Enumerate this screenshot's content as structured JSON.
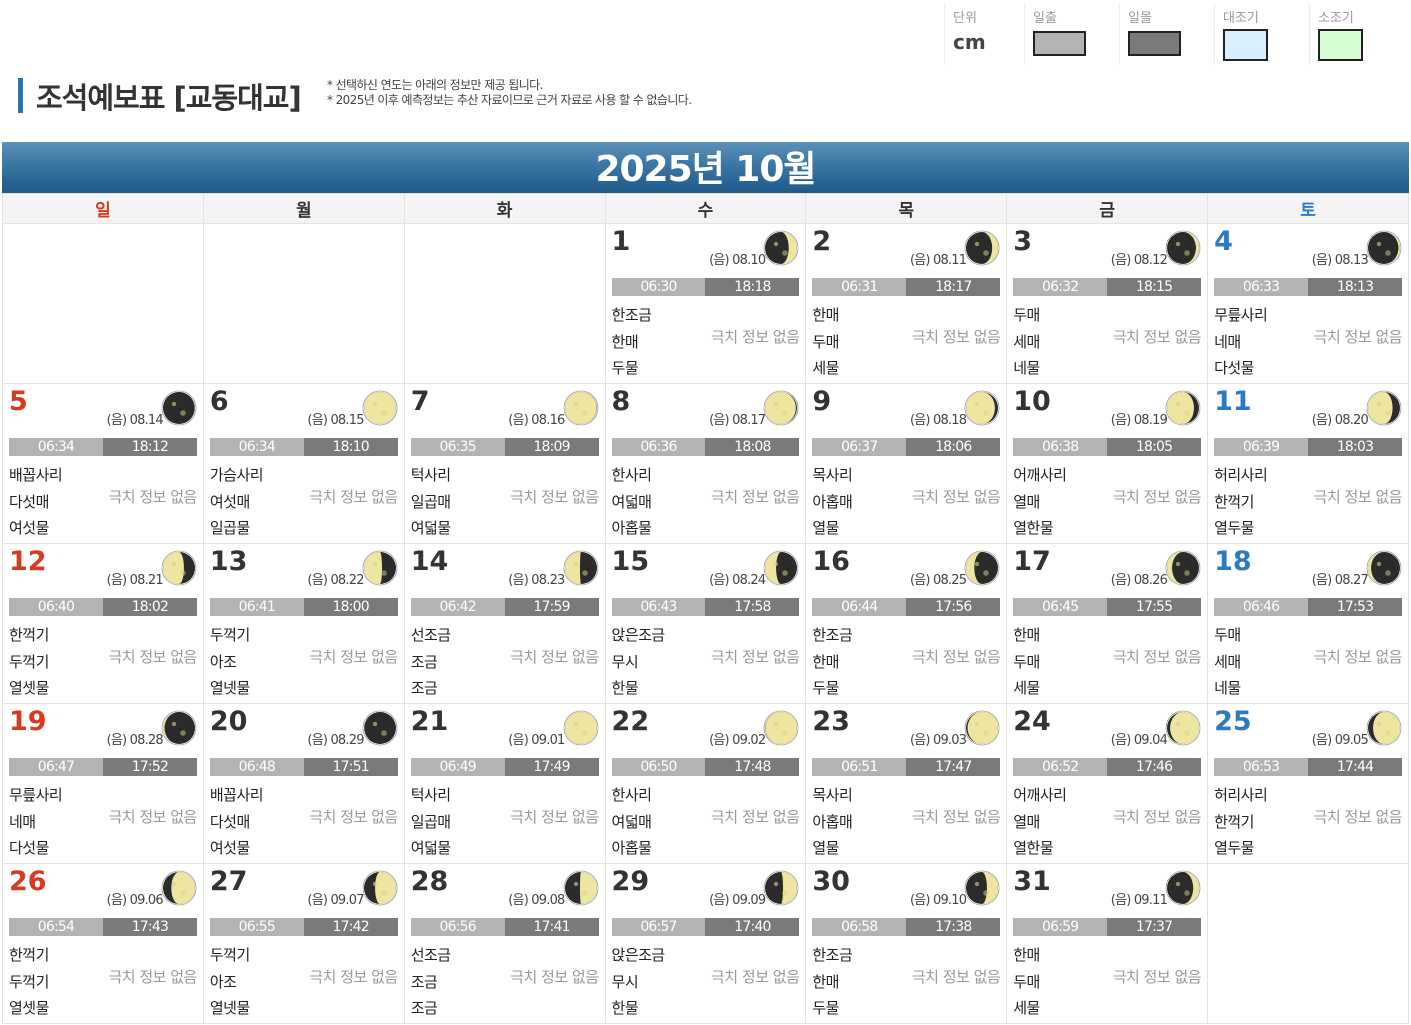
{
  "legend": {
    "unit": {
      "label": "단위",
      "value": "cm"
    },
    "items": [
      {
        "label": "일출",
        "color": "#b3b3b3"
      },
      {
        "label": "일몰",
        "color": "#7a7a7a"
      },
      {
        "label": "대조기",
        "color": "#d9eeff"
      },
      {
        "label": "소조기",
        "color": "#d6fcd4"
      }
    ]
  },
  "header": {
    "title": "조석예보표 [교동대교]",
    "notice_1": "* 선택하신 연도는 아래의 정보만 제공 됩니다.",
    "notice_2": "* 2025년 이후 예측정보는 추산 자료이므로 근거 자료로 사용 할 수 없습니다."
  },
  "calendar": {
    "month_title": "2025년 10월",
    "weekdays": [
      "일",
      "월",
      "화",
      "수",
      "목",
      "금",
      "토"
    ],
    "no_info_label": "극치 정보 없음",
    "days": [
      {
        "day": "1",
        "lunar": "(음) 08.10",
        "sunrise": "06:30",
        "sunset": "18:18",
        "tide": [
          "한조금",
          "한매",
          "두물"
        ],
        "phase": 0.33
      },
      {
        "day": "2",
        "lunar": "(음) 08.11",
        "sunrise": "06:31",
        "sunset": "18:17",
        "tide": [
          "한매",
          "두매",
          "세물"
        ],
        "phase": 0.36
      },
      {
        "day": "3",
        "lunar": "(음) 08.12",
        "sunrise": "06:32",
        "sunset": "18:15",
        "tide": [
          "두매",
          "세매",
          "네물"
        ],
        "phase": 0.4
      },
      {
        "day": "4",
        "lunar": "(음) 08.13",
        "sunrise": "06:33",
        "sunset": "18:13",
        "tide": [
          "무릎사리",
          "네매",
          "다섯물"
        ],
        "phase": 0.43
      },
      {
        "day": "5",
        "lunar": "(음) 08.14",
        "sunrise": "06:34",
        "sunset": "18:12",
        "tide": [
          "배꼽사리",
          "다섯매",
          "여섯물"
        ],
        "phase": 0.47
      },
      {
        "day": "6",
        "lunar": "(음) 08.15",
        "sunrise": "06:34",
        "sunset": "18:10",
        "tide": [
          "가슴사리",
          "여섯매",
          "일곱물"
        ],
        "phase": 0.5
      },
      {
        "day": "7",
        "lunar": "(음) 08.16",
        "sunrise": "06:35",
        "sunset": "18:09",
        "tide": [
          "턱사리",
          "일곱매",
          "여덟물"
        ],
        "phase": 0.53
      },
      {
        "day": "8",
        "lunar": "(음) 08.17",
        "sunrise": "06:36",
        "sunset": "18:08",
        "tide": [
          "한사리",
          "여덟매",
          "아홉물"
        ],
        "phase": 0.56
      },
      {
        "day": "9",
        "lunar": "(음) 08.18",
        "sunrise": "06:37",
        "sunset": "18:06",
        "tide": [
          "목사리",
          "아홉매",
          "열물"
        ],
        "phase": 0.6
      },
      {
        "day": "10",
        "lunar": "(음) 08.19",
        "sunrise": "06:38",
        "sunset": "18:05",
        "tide": [
          "어깨사리",
          "열매",
          "열한물"
        ],
        "phase": 0.63
      },
      {
        "day": "11",
        "lunar": "(음) 08.20",
        "sunrise": "06:39",
        "sunset": "18:03",
        "tide": [
          "허리사리",
          "한꺽기",
          "열두물"
        ],
        "phase": 0.66
      },
      {
        "day": "12",
        "lunar": "(음) 08.21",
        "sunrise": "06:40",
        "sunset": "18:02",
        "tide": [
          "한꺽기",
          "두꺽기",
          "열셋물"
        ],
        "phase": 0.7
      },
      {
        "day": "13",
        "lunar": "(음) 08.22",
        "sunrise": "06:41",
        "sunset": "18:00",
        "tide": [
          "두꺽기",
          "아조",
          "열넷물"
        ],
        "phase": 0.73
      },
      {
        "day": "14",
        "lunar": "(음) 08.23",
        "sunrise": "06:42",
        "sunset": "17:59",
        "tide": [
          "선조금",
          "조금",
          "조금"
        ],
        "phase": 0.76
      },
      {
        "day": "15",
        "lunar": "(음) 08.24",
        "sunrise": "06:43",
        "sunset": "17:58",
        "tide": [
          "앉은조금",
          "무시",
          "한물"
        ],
        "phase": 0.8
      },
      {
        "day": "16",
        "lunar": "(음) 08.25",
        "sunrise": "06:44",
        "sunset": "17:56",
        "tide": [
          "한조금",
          "한매",
          "두물"
        ],
        "phase": 0.83
      },
      {
        "day": "17",
        "lunar": "(음) 08.26",
        "sunrise": "06:45",
        "sunset": "17:55",
        "tide": [
          "한매",
          "두매",
          "세물"
        ],
        "phase": 0.87
      },
      {
        "day": "18",
        "lunar": "(음) 08.27",
        "sunrise": "06:46",
        "sunset": "17:53",
        "tide": [
          "두매",
          "세매",
          "네물"
        ],
        "phase": 0.9
      },
      {
        "day": "19",
        "lunar": "(음) 08.28",
        "sunrise": "06:47",
        "sunset": "17:52",
        "tide": [
          "무릎사리",
          "네매",
          "다섯물"
        ],
        "phase": 0.93
      },
      {
        "day": "20",
        "lunar": "(음) 08.29",
        "sunrise": "06:48",
        "sunset": "17:51",
        "tide": [
          "배꼽사리",
          "다섯매",
          "여섯물"
        ],
        "phase": 0.97
      },
      {
        "day": "21",
        "lunar": "(음) 09.01",
        "sunrise": "06:49",
        "sunset": "17:49",
        "tide": [
          "턱사리",
          "일곱매",
          "여덟물"
        ],
        "phase": 0.0
      },
      {
        "day": "22",
        "lunar": "(음) 09.02",
        "sunrise": "06:50",
        "sunset": "17:48",
        "tide": [
          "한사리",
          "여덟매",
          "아홉물"
        ],
        "phase": 0.03
      },
      {
        "day": "23",
        "lunar": "(음) 09.03",
        "sunrise": "06:51",
        "sunset": "17:47",
        "tide": [
          "목사리",
          "아홉매",
          "열물"
        ],
        "phase": 0.07
      },
      {
        "day": "24",
        "lunar": "(음) 09.04",
        "sunrise": "06:52",
        "sunset": "17:46",
        "tide": [
          "어깨사리",
          "열매",
          "열한물"
        ],
        "phase": 0.1
      },
      {
        "day": "25",
        "lunar": "(음) 09.05",
        "sunrise": "06:53",
        "sunset": "17:44",
        "tide": [
          "허리사리",
          "한꺽기",
          "열두물"
        ],
        "phase": 0.13
      },
      {
        "day": "26",
        "lunar": "(음) 09.06",
        "sunrise": "06:54",
        "sunset": "17:43",
        "tide": [
          "한꺽기",
          "두꺽기",
          "열셋물"
        ],
        "phase": 0.17
      },
      {
        "day": "27",
        "lunar": "(음) 09.07",
        "sunrise": "06:55",
        "sunset": "17:42",
        "tide": [
          "두꺽기",
          "아조",
          "열넷물"
        ],
        "phase": 0.2
      },
      {
        "day": "28",
        "lunar": "(음) 09.08",
        "sunrise": "06:56",
        "sunset": "17:41",
        "tide": [
          "선조금",
          "조금",
          "조금"
        ],
        "phase": 0.24
      },
      {
        "day": "29",
        "lunar": "(음) 09.09",
        "sunrise": "06:57",
        "sunset": "17:40",
        "tide": [
          "앉은조금",
          "무시",
          "한물"
        ],
        "phase": 0.27
      },
      {
        "day": "30",
        "lunar": "(음) 09.10",
        "sunrise": "06:58",
        "sunset": "17:38",
        "tide": [
          "한조금",
          "한매",
          "두물"
        ],
        "phase": 0.3
      },
      {
        "day": "31",
        "lunar": "(음) 09.11",
        "sunrise": "06:59",
        "sunset": "17:37",
        "tide": [
          "한매",
          "두매",
          "세물"
        ],
        "phase": 0.36
      }
    ]
  }
}
